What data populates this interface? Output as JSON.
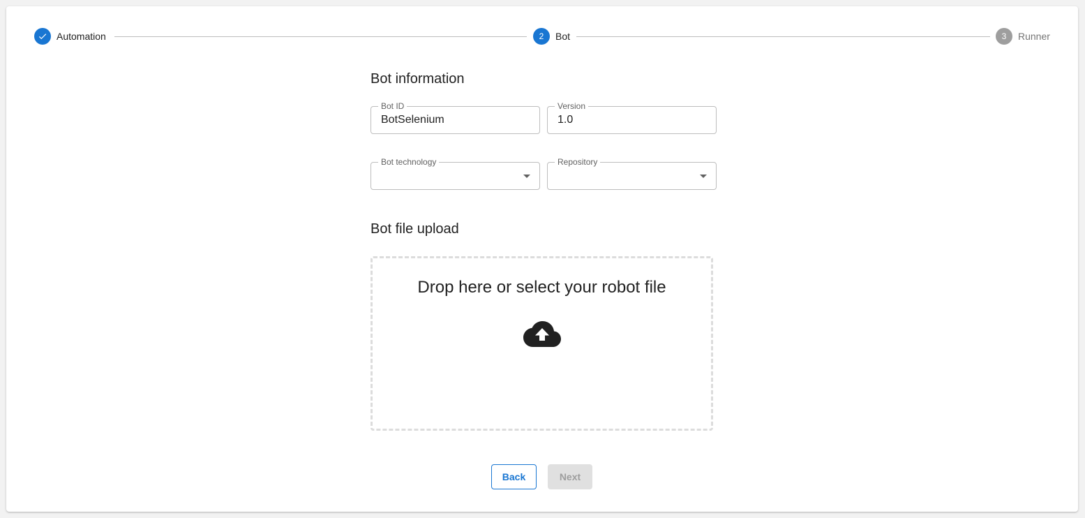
{
  "stepper": {
    "steps": [
      {
        "index": "1",
        "label": "Automation",
        "state": "completed"
      },
      {
        "index": "2",
        "label": "Bot",
        "state": "active"
      },
      {
        "index": "3",
        "label": "Runner",
        "state": "pending"
      }
    ]
  },
  "bot_information": {
    "title": "Bot information",
    "bot_id": {
      "label": "Bot ID",
      "value": "BotSelenium"
    },
    "version": {
      "label": "Version",
      "value": "1.0"
    },
    "bot_technology": {
      "label": "Bot technology",
      "value": ""
    },
    "repository": {
      "label": "Repository",
      "value": ""
    }
  },
  "bot_file_upload": {
    "title": "Bot file upload",
    "dropzone_text": "Drop here or select your robot file",
    "icon": "cloud-upload-icon"
  },
  "actions": {
    "back_label": "Back",
    "next_label": "Next"
  },
  "colors": {
    "primary": "#1976d2",
    "pending": "#9e9e9e",
    "disabled_bg": "#e0e0e0"
  }
}
